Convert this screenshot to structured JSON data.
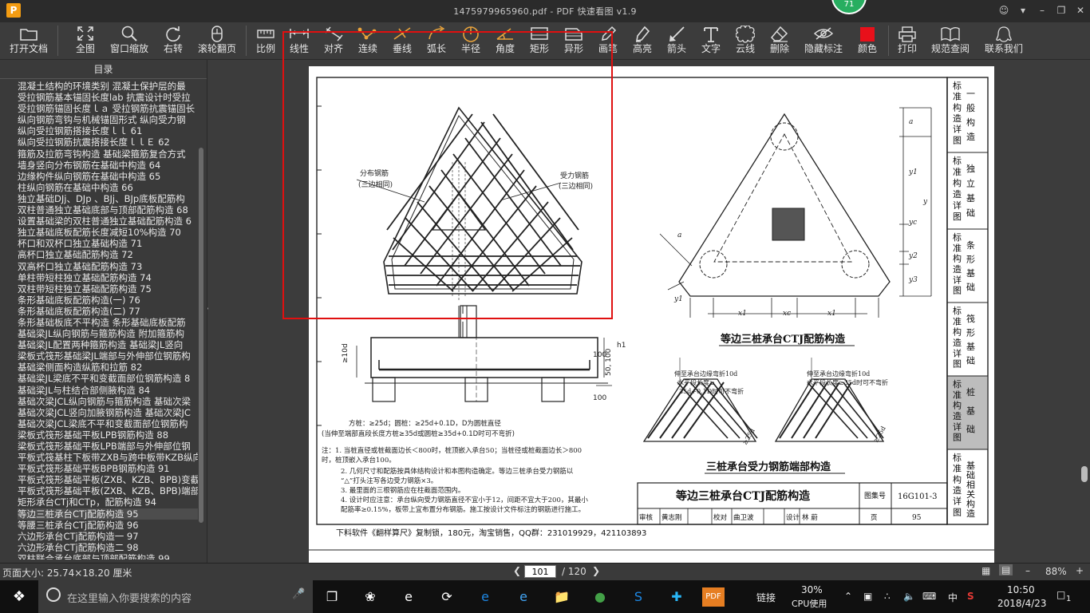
{
  "window": {
    "title": "1475979965960.pdf - PDF 快速看图 v1.9",
    "badge": "71",
    "app_icon": "P"
  },
  "toolbar": [
    {
      "id": "open",
      "label": "打开文档",
      "icon": "folder-icon"
    },
    {
      "id": "fit",
      "label": "全图",
      "icon": "fullscreen-icon"
    },
    {
      "id": "window-zoom",
      "label": "窗口缩放",
      "icon": "magnifier-icon"
    },
    {
      "id": "rotate",
      "label": "右转",
      "icon": "rotate-icon"
    },
    {
      "id": "scroll-page",
      "label": "滚轮翻页",
      "icon": "mouse-icon"
    },
    {
      "id": "scale",
      "label": "比例",
      "icon": "ruler-icon"
    },
    {
      "id": "linear",
      "label": "线性",
      "icon": "linear-dim-icon"
    },
    {
      "id": "aligned",
      "label": "对齐",
      "icon": "aligned-dim-icon"
    },
    {
      "id": "continuous",
      "label": "连续",
      "icon": "continuous-dim-icon"
    },
    {
      "id": "perpendicular",
      "label": "垂线",
      "icon": "perpendicular-icon"
    },
    {
      "id": "arc",
      "label": "弧长",
      "icon": "arc-length-icon"
    },
    {
      "id": "radius",
      "label": "半径",
      "icon": "radius-icon"
    },
    {
      "id": "angle",
      "label": "角度",
      "icon": "angle-icon"
    },
    {
      "id": "rect",
      "label": "矩形",
      "icon": "rectangle-icon"
    },
    {
      "id": "irregular",
      "label": "异形",
      "icon": "irregular-shape-icon"
    },
    {
      "id": "brush",
      "label": "画笔",
      "icon": "brush-icon"
    },
    {
      "id": "highlight",
      "label": "高亮",
      "icon": "highlighter-icon"
    },
    {
      "id": "arrow",
      "label": "箭头",
      "icon": "arrow-icon"
    },
    {
      "id": "text",
      "label": "文字",
      "icon": "text-icon"
    },
    {
      "id": "cloud",
      "label": "云线",
      "icon": "cloud-line-icon"
    },
    {
      "id": "delete",
      "label": "删除",
      "icon": "eraser-icon"
    },
    {
      "id": "hide",
      "label": "隐藏标注",
      "icon": "eye-hidden-icon"
    },
    {
      "id": "color",
      "label": "颜色",
      "icon": "color-swatch-icon",
      "color": "#e8101a"
    },
    {
      "id": "print",
      "label": "打印",
      "icon": "printer-icon"
    },
    {
      "id": "spec",
      "label": "规范查阅",
      "icon": "book-icon"
    },
    {
      "id": "contact",
      "label": "联系我们",
      "icon": "contact-icon"
    }
  ],
  "sidebar": {
    "header": "目录",
    "items": [
      "混凝土结构的环境类别 混凝土保护层的最",
      "受拉钢筋基本锚固长度lab 抗震设计时受拉",
      "受拉钢筋锚固长度ｌａ 受拉钢筋抗震锚固长",
      "纵向钢筋弯钩与机械锚固形式 纵向受力钢",
      "纵向受拉钢筋搭接长度ｌｌ 61",
      "纵向受拉钢筋抗震搭接长度ｌｌＥ 62",
      "箍筋及拉筋弯钩构造 基础梁箍筋复合方式",
      "墙身竖向分布钢筋在基础中构造 64",
      "边缘构件纵向钢筋在基础中构造 65",
      "柱纵向钢筋在基础中构造 66",
      "独立基础DJj、DJp 、BJj、BJp底板配筋构",
      "双柱普通独立基础底部与顶部配筋构造 68",
      "设置基础梁的双柱普通独立基础配筋构造 6",
      "独立基础底板配筋长度减短10%构造 70",
      "杯口和双杯口独立基础构造 71",
      "高杯口独立基础配筋构造 72",
      "双高杯口独立基础配筋构造 73",
      "单柱带短柱独立基础配筋构造 74",
      "双柱带短柱独立基础配筋构造 75",
      "条形基础底板配筋构造(一) 76",
      "条形基础底板配筋构造(二) 77",
      "条形基础板底不平构造 条形基础底板配筋",
      "基础梁JL纵向钢筋与箍筋构造 附加箍筋构",
      "基础梁JL配置两种箍筋构造 基础梁JL竖向",
      "梁板式筏形基础梁JL端部与外伸部位钢筋构",
      "基础梁侧面构造纵筋和拉筋 82",
      "基础梁JL梁底不平和变截面部位钢筋构造 8",
      "基础梁JL与柱结合部侧腋构造 84",
      "基础次梁JCL纵向钢筋与箍筋构造 基础次梁",
      "基础次梁JCL竖向加腋钢筋构造 基础次梁JC",
      "基础次梁JCL梁底不平和变截面部位钢筋构",
      "梁板式筏形基础平板LPB钢筋构造 88",
      "梁板式筏形基础平板LPB端部与外伸部位钢",
      "平板式筏基柱下板带ZXB与跨中板带KZB纵向",
      "平板式筏形基础平板BPB钢筋构造 91",
      "平板式筏形基础平板(ZXB、KZB、BPB)变截",
      "平板式筏形基础平板(ZXB、KZB、BPB)端部",
      "矩形承台CTj和CTp，配筋构造 94",
      "等边三桩承台CTj配筋构造 95",
      "等腰三桩承台CTj配筋构造 96",
      "六边形承台CTj配筋构造一 97",
      "六边形承台CTj配筋构造二 98",
      "双柱联合承台底部与顶部配筋构造 99"
    ],
    "selected_index": 38
  },
  "drawing": {
    "left_labels": {
      "dist_bar": "分布钢筋",
      "dist_bar_sub": "(三边相同)",
      "main_bar": "受力钢筋",
      "main_bar_sub": "(三边相同)",
      "d10": "≥10d",
      "dim100": "100",
      "dim50": "50, 100",
      "h1": "h1",
      "dim100b": "100",
      "note1": "方桩：≥25d；圆桩：≥25d+0.1D，D为圆桩直径",
      "note2": "(当伸至端部直段长度方桩≥35d或圆桩≥35d+0.1D时可不弯折)"
    },
    "plan_title": "等边三桩承台CTJ配筋构造",
    "end_title": "三桩承台受力钢筋端部构造",
    "end_l1": "伸至承台边缘弯折10d",
    "end_l2": "水平段长度≥",
    "end_l3": "35d+0.1D时可不弯折",
    "end_r1": "伸至承台边缘弯折10d",
    "end_r2": "水平段长度≥35d时可不弯折",
    "dims": {
      "a": "a",
      "y1": "y1",
      "yc": "yc",
      "y2": "y2",
      "y3": "y3",
      "y": "y",
      "x1": "x1",
      "xc": "xc",
      "x2": "x1",
      "a2": "a",
      "y4": "y1",
      "d25": "≥25d",
      "d25b": "≥25d"
    },
    "notes": [
      "注：1. 当桩直径或桩截面边长＜800时，桩顶嵌入承台50；当桩径或桩截面边长＞800",
      "     时，桩顶嵌入承台100。",
      "2. 几何尺寸和配筋按具体结构设计和本图构造确定。等边三桩承台受力钢筋以",
      "   “△”打头注写各边受力钢筋×3。",
      "3. 最里面的三根钢筋应在柱截面范围内。",
      "4. 设计时应注意：承台纵向受力钢筋直径不宜小于12，间距不宜大于200，其最小",
      "   配筋率≥0.15%，板带上宜布置分布钢筋。施工按设计文件标注的钢筋进行施工。"
    ],
    "titleblock": {
      "main_title": "等边三桩承台CTJ配筋构造",
      "set_label": "图集号",
      "set_no": "16G101-3",
      "review": "审核",
      "reviewer": "黄志刚",
      "check": "校对",
      "checker": "曲卫波",
      "design": "设计",
      "designer": "林 蔚",
      "page_label": "页",
      "page_no": "95"
    },
    "side_tabs": [
      {
        "a": "标准构造详图",
        "b": "一般构造"
      },
      {
        "a": "标准构造详图",
        "b": "独立基础"
      },
      {
        "a": "标准构造详图",
        "b": "条形基础"
      },
      {
        "a": "标准构造详图",
        "b": "筏形基础"
      },
      {
        "a": "标准构造详图",
        "b": "桩基础"
      },
      {
        "a": "标准构造详图",
        "b": "基础相关构造"
      }
    ],
    "active_side_tab": 4,
    "footer_ad": "下料软件《翻样算尺》复制锁，180元，淘宝销售，QQ群：231019929，421103893"
  },
  "status": {
    "page_size": "页面大小: 25.74×18.20 厘米",
    "current_page": "101",
    "total_pages": "/ 120",
    "zoom": "88%"
  },
  "taskbar": {
    "search_placeholder": "在这里输入你要搜索的内容",
    "pinned": [
      "task-view-icon",
      "fan-icon",
      "edge-icon",
      "spiral-icon",
      "ie-icon",
      "ie-alt-icon",
      "folder-icon",
      "360-browser-icon",
      "sogou-icon",
      "tool-icon",
      "pdf-reader-icon"
    ],
    "link_label": "链接",
    "cpu_pct": "30%",
    "cpu_label": "CPU使用",
    "ime": "中",
    "time": "10:50",
    "date": "2018/4/23",
    "notif_count": "1"
  }
}
